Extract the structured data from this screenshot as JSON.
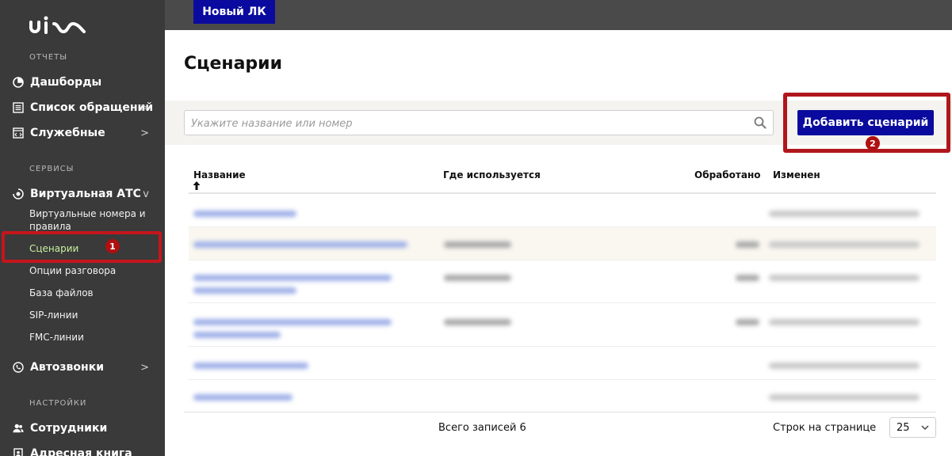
{
  "app": {
    "logo_text": "uiscom"
  },
  "sidebar": {
    "sections": {
      "reports": "ОТЧЕТЫ",
      "services": "СЕРВИСЫ",
      "settings": "НАСТРОЙКИ"
    },
    "items": {
      "dashboards": "Дашборды",
      "requests": "Список обращений",
      "service": "Служебные",
      "vats": "Виртуальная АТС",
      "autocalls": "Автозвонки",
      "employees": "Сотрудники",
      "addressbook": "Адресная книга"
    },
    "subitems": {
      "numbers": "Виртуальные номера и правила",
      "scenarios": "Сценарии",
      "options": "Опции разговора",
      "files": "База файлов",
      "sip": "SIP-линии",
      "fmc": "FMC-линии"
    },
    "chevron_right": ">",
    "chevron_down": "v"
  },
  "topbar": {
    "new_lk": "Новый ЛК"
  },
  "page": {
    "title": "Сценарии"
  },
  "search": {
    "placeholder": "Укажите название или номер"
  },
  "actions": {
    "add_scenario": "Добавить сценарий"
  },
  "badges": {
    "one": "1",
    "two": "2"
  },
  "table": {
    "columns": {
      "name": "Название",
      "used_in": "Где используется",
      "processed": "Обработано",
      "changed": "Изменен"
    }
  },
  "footer": {
    "total": "Всего записей 6",
    "rows_per_page_label": "Строк на странице",
    "rows_per_page_value": "25"
  },
  "colors": {
    "sidebar_bg": "#3a3a3a",
    "primary_button": "#0a0a9e",
    "highlight_frame": "#c4161c",
    "active_subitem": "#c8f0a0"
  }
}
